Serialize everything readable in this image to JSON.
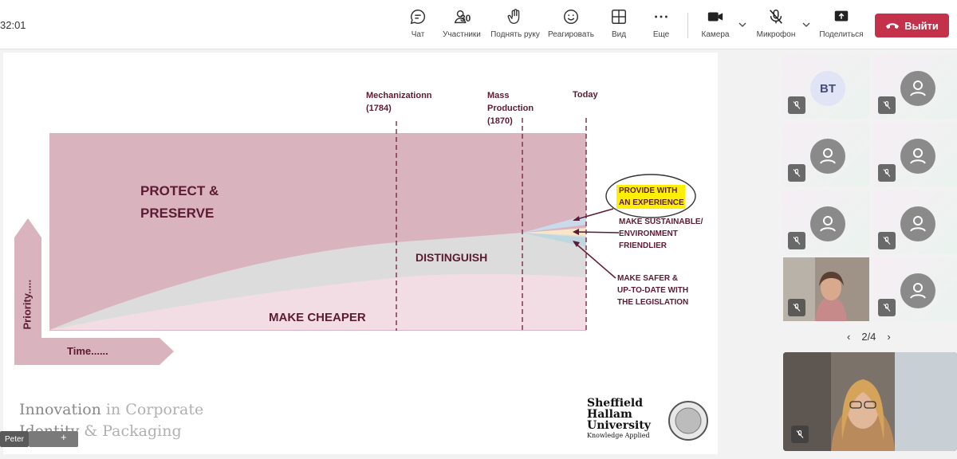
{
  "meeting": {
    "timer": "32:01",
    "participants_count": "30",
    "toolbar": {
      "chat": "Чат",
      "participants": "Участники",
      "raise_hand": "Поднять руку",
      "react": "Реагировать",
      "view": "Вид",
      "more": "Еще",
      "camera": "Камера",
      "mic": "Микрофон",
      "share": "Поделиться",
      "leave": "Выйти"
    },
    "leave_color": "#c4314b"
  },
  "slide": {
    "milestones": [
      {
        "label": "Mechanizationn\n(1784)"
      },
      {
        "label": "Mass\nProduction\n(1870)"
      },
      {
        "label": "Today"
      }
    ],
    "bands": {
      "protect": "PROTECT &\nPRESERVE",
      "distinguish": "DISTINGUISH",
      "cheaper": "MAKE CHEAPER"
    },
    "axis": {
      "y": "Priority.....",
      "x": "Time......"
    },
    "branches": {
      "experience": "PROVIDE WITH\nAN EXPERIENCE",
      "sustainable": "MAKE SUSTAINABLE/\nENVIRONMENT\nFRIENDLIER",
      "safer": "MAKE SAFER &\nUP-TO-DATE WITH\nTHE LEGISLATION"
    },
    "footer": {
      "line1a": "Innovation",
      "line1b": "in Corporate",
      "line2a": "Identity",
      "line2b": "& Packaging"
    },
    "logo": {
      "line1": "Sheffield",
      "line2": "Hallam",
      "line3": "University",
      "line4": "Knowledge Applied"
    },
    "colors": {
      "protect": "#d9b3be",
      "distinguish": "#dcdcdc",
      "cheaper": "#f2dde4",
      "text": "#5c1a33",
      "highlight": "#ffef00"
    }
  },
  "gallery": {
    "tiles": [
      {
        "initials": "BT"
      },
      {
        "initials": ""
      },
      {
        "initials": ""
      },
      {
        "initials": ""
      },
      {
        "initials": ""
      },
      {
        "initials": ""
      },
      {
        "initials": ""
      },
      {
        "initials": ""
      }
    ],
    "page": "2/4",
    "presenter_chip": "Peter"
  }
}
